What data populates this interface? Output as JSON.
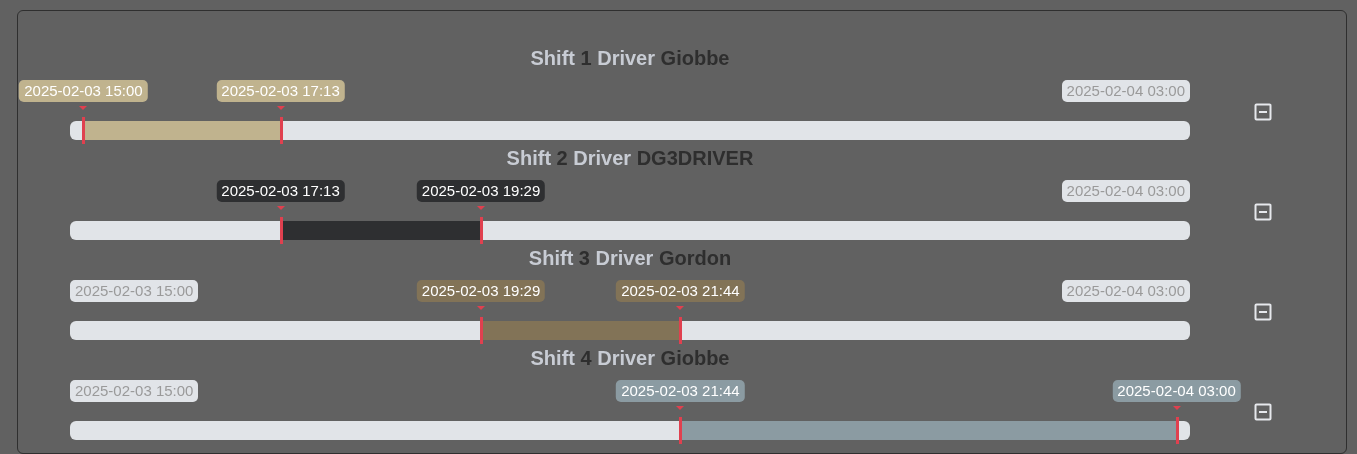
{
  "shifts": [
    {
      "shift_label": "Shift",
      "number": "1",
      "driver_label": "Driver",
      "driver": "Giobbe",
      "color": "#c0b38e",
      "range_end_label": "2025-02-04 03:00",
      "markers": [
        {
          "label": "2025-02-03 15:00",
          "level": 0.012
        },
        {
          "label": "2025-02-03 17:13",
          "level": 0.188
        }
      ]
    },
    {
      "shift_label": "Shift",
      "number": "2",
      "driver_label": "Driver",
      "driver": "DG3DRIVER",
      "color": "#2e2f31",
      "range_end_label": "2025-02-04 03:00",
      "markers": [
        {
          "label": "2025-02-03 17:13",
          "level": 0.188
        },
        {
          "label": "2025-02-03 19:29",
          "level": 0.367
        }
      ]
    },
    {
      "shift_label": "Shift",
      "number": "3",
      "driver_label": "Driver",
      "driver": "Gordon",
      "color": "#827357",
      "range_start_label": "2025-02-03 15:00",
      "range_end_label": "2025-02-04 03:00",
      "markers": [
        {
          "label": "2025-02-03 19:29",
          "level": 0.367
        },
        {
          "label": "2025-02-03 21:44",
          "level": 0.545
        }
      ]
    },
    {
      "shift_label": "Shift",
      "number": "4",
      "driver_label": "Driver",
      "driver": "Giobbe",
      "color": "#8b9ba2",
      "range_start_label": "2025-02-03 15:00",
      "markers": [
        {
          "label": "2025-02-03 21:44",
          "level": 0.545
        },
        {
          "label": "2025-02-04 03:00",
          "level": 0.988
        }
      ]
    }
  ]
}
